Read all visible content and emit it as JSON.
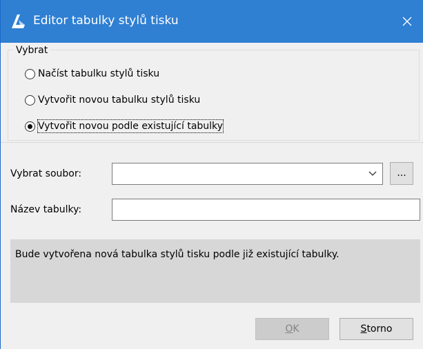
{
  "window": {
    "title": "Editor tabulky stylů tisku",
    "close_glyph": "✕"
  },
  "group": {
    "legend": "Vybrat",
    "options": [
      {
        "label": "Načíst tabulku stylů tisku",
        "checked": false
      },
      {
        "label": "Vytvořit novou tabulku stylů tisku",
        "checked": false
      },
      {
        "label": "Vytvořit novou podle existující tabulky",
        "checked": true
      }
    ]
  },
  "file": {
    "label": "Vybrat soubor:",
    "value": "",
    "browse_label": "..."
  },
  "table_name": {
    "label": "Název tabulky:",
    "value": "",
    "placeholder": ""
  },
  "info": {
    "text": "Bude vytvořena nová tabulka stylů tisku podle již existující tabulky."
  },
  "buttons": {
    "ok_mnemonic": "O",
    "ok_rest": "K",
    "ok_enabled": false,
    "cancel_mnemonic": "S",
    "cancel_rest": "torno"
  },
  "colors": {
    "titlebar": "#2f7fd3",
    "dialog_bg": "#f0f0f0",
    "info_bg": "#d7d7d7"
  },
  "icons": {
    "app": "bricscad-logo-icon",
    "close": "close-icon",
    "dropdown": "chevron-down-icon"
  }
}
